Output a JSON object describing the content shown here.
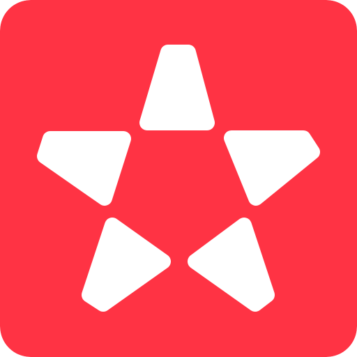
{
  "icon": {
    "name": "star-app-icon",
    "background_color": "#FF3344",
    "foreground_color": "#FFFFFF"
  }
}
